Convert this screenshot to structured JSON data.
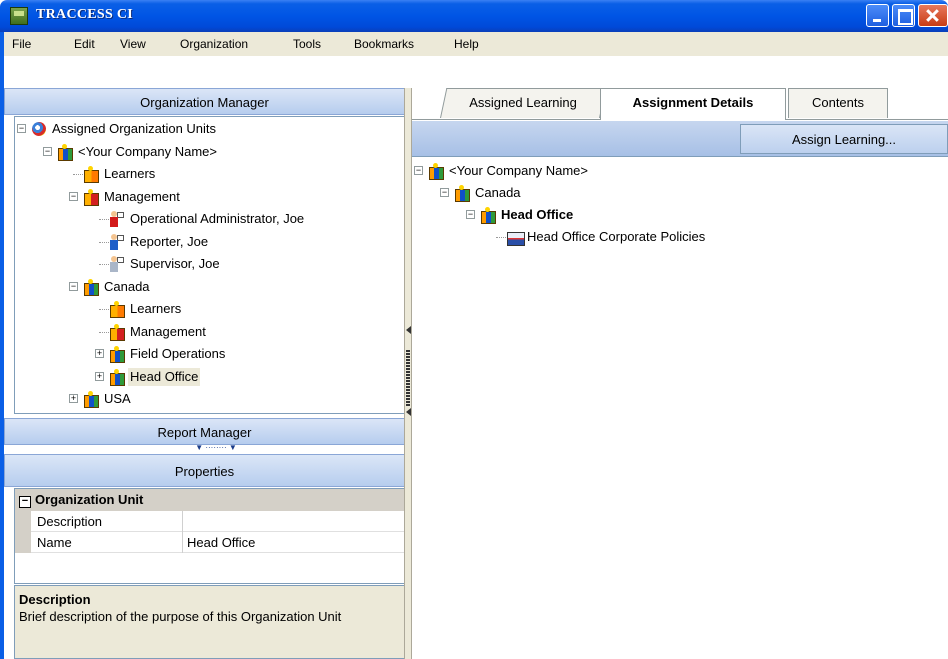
{
  "window": {
    "title": "TRACCESS CI"
  },
  "menu": [
    "File",
    "Edit",
    "View",
    "Organization",
    "Tools",
    "Bookmarks",
    "Help"
  ],
  "left": {
    "org_manager_title": "Organization Manager",
    "report_manager_title": "Report Manager",
    "properties_title": "Properties",
    "tree": [
      {
        "label": "Assigned Organization Units",
        "icon": "org-root-icon",
        "depth": 0,
        "toggle": "−"
      },
      {
        "label": "<Your Company Name>",
        "icon": "gift-icon",
        "depth": 1,
        "toggle": "−"
      },
      {
        "label": "Learners",
        "icon": "learners-gift-icon",
        "depth": 2,
        "toggle": ""
      },
      {
        "label": "Management",
        "icon": "management-gift-icon",
        "depth": 2,
        "toggle": "−"
      },
      {
        "label": "Operational Administrator, Joe",
        "icon": "admin-user-icon",
        "depth": 3,
        "toggle": ""
      },
      {
        "label": "Reporter, Joe",
        "icon": "reporter-user-icon",
        "depth": 3,
        "toggle": ""
      },
      {
        "label": "Supervisor, Joe",
        "icon": "supervisor-user-icon",
        "depth": 3,
        "toggle": ""
      },
      {
        "label": "Canada",
        "icon": "gift-icon",
        "depth": 2,
        "toggle": "−"
      },
      {
        "label": "Learners",
        "icon": "learners-gift-icon",
        "depth": 3,
        "toggle": ""
      },
      {
        "label": "Management",
        "icon": "management-gift-icon",
        "depth": 3,
        "toggle": ""
      },
      {
        "label": "Field Operations",
        "icon": "gift-icon",
        "depth": 3,
        "toggle": "+"
      },
      {
        "label": "Head Office",
        "icon": "gift-icon",
        "depth": 3,
        "toggle": "+",
        "selected": true
      },
      {
        "label": "USA",
        "icon": "gift-icon",
        "depth": 2,
        "toggle": "+"
      }
    ],
    "properties": {
      "category": "Organization Unit",
      "category_toggle": "−",
      "rows": [
        {
          "key": "Description",
          "value": ""
        },
        {
          "key": "Name",
          "value": "Head Office"
        }
      ],
      "description_title": "Description",
      "description_text": "Brief description of the purpose of this Organization Unit"
    }
  },
  "right": {
    "tabs": [
      "Assigned Learning",
      "Assignment Details",
      "Contents"
    ],
    "active_tab": "Assignment Details",
    "assign_button": "Assign Learning...",
    "tree": [
      {
        "label": "<Your Company Name>",
        "icon": "gift-icon",
        "depth": 0,
        "toggle": "−"
      },
      {
        "label": "Canada",
        "icon": "gift-icon",
        "depth": 1,
        "toggle": "−"
      },
      {
        "label": "Head Office",
        "icon": "gift-icon",
        "depth": 2,
        "toggle": "−",
        "bold": true
      },
      {
        "label": "Head Office Corporate Policies",
        "icon": "course-icon",
        "depth": 3,
        "toggle": ""
      }
    ]
  }
}
